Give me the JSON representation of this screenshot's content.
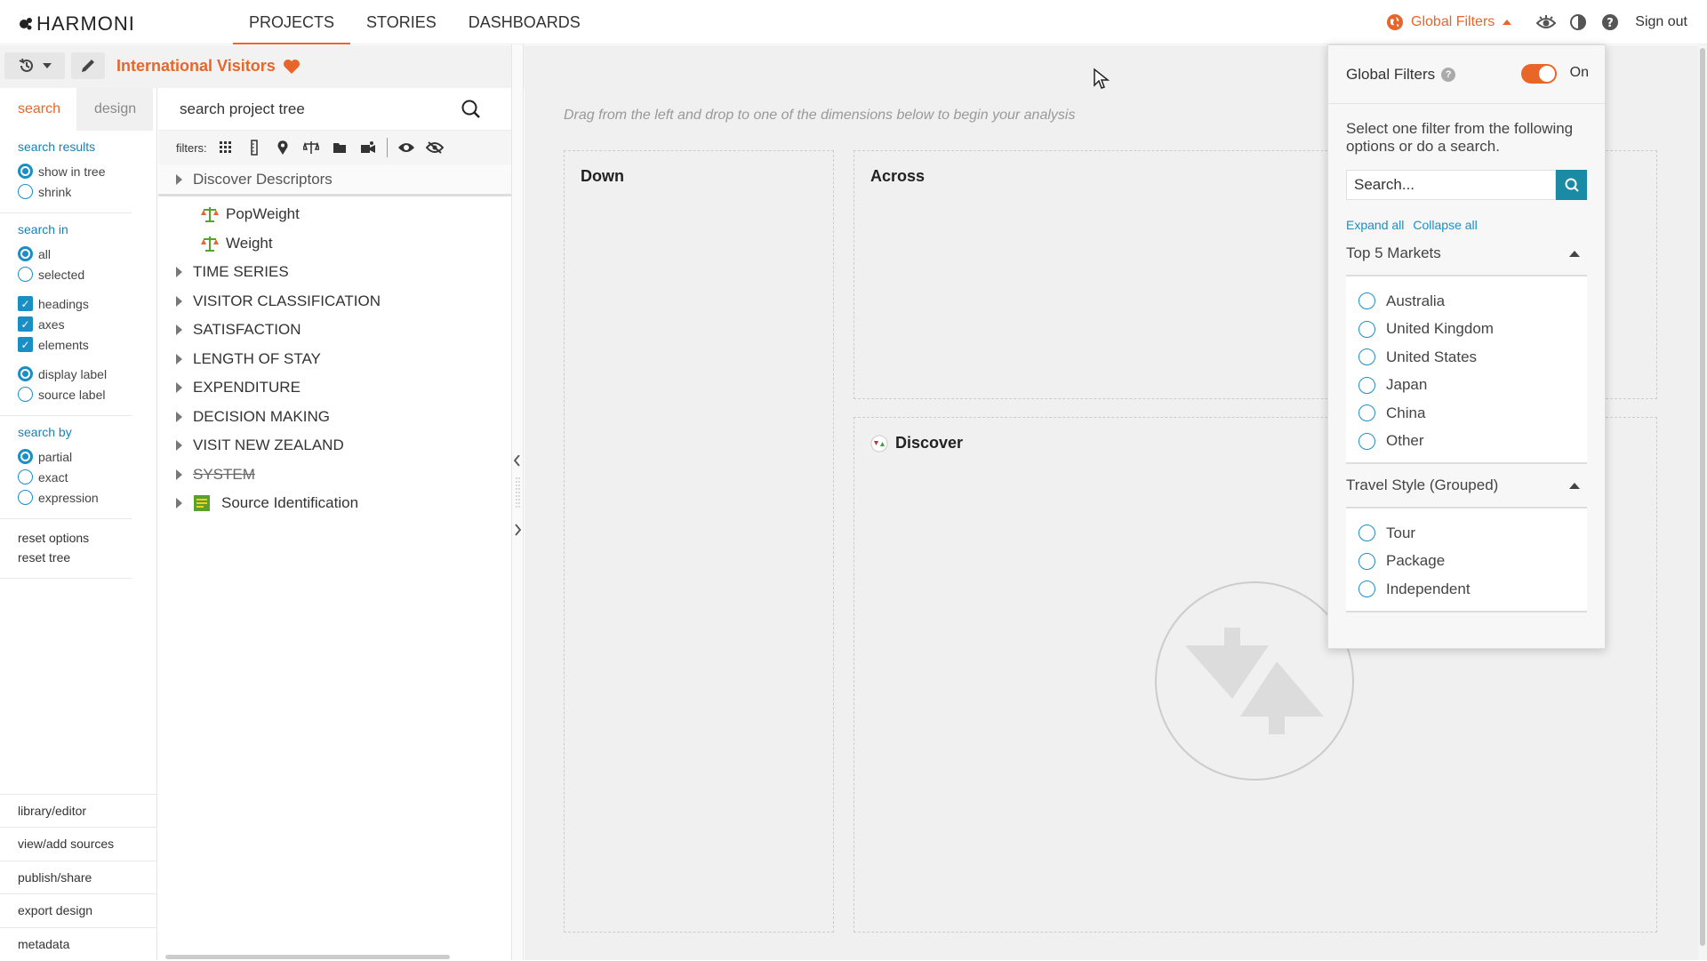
{
  "app": {
    "logo_text": "HARMONI"
  },
  "nav": {
    "items": [
      {
        "label": "PROJECTS",
        "active": true
      },
      {
        "label": "STORIES",
        "active": false
      },
      {
        "label": "DASHBOARDS",
        "active": false
      }
    ]
  },
  "header_right": {
    "global_filters_label": "Global Filters",
    "sign_out": "Sign out"
  },
  "project": {
    "title": "International Visitors"
  },
  "left_tabs": {
    "search": "search",
    "design": "design"
  },
  "options": {
    "search_results": {
      "title": "search results",
      "items": [
        "show in tree",
        "shrink"
      ],
      "selected": 0
    },
    "search_in": {
      "title": "search in",
      "items": [
        "all",
        "selected"
      ],
      "selected": 0
    },
    "checks": [
      "headings",
      "axes",
      "elements"
    ],
    "labels": {
      "items": [
        "display label",
        "source label"
      ],
      "selected": 0
    },
    "search_by": {
      "title": "search by",
      "items": [
        "partial",
        "exact",
        "expression"
      ],
      "selected": 0
    },
    "reset": [
      "reset options",
      "reset tree"
    ]
  },
  "bottom_links": [
    "library/editor",
    "view/add sources",
    "publish/share",
    "export design",
    "metadata"
  ],
  "tree": {
    "search_placeholder": "search project tree",
    "filters_label": "filters:",
    "head": "Discover Descriptors",
    "leaves": [
      "PopWeight",
      "Weight"
    ],
    "folders": [
      "TIME SERIES",
      "VISITOR CLASSIFICATION",
      "SATISFACTION",
      "LENGTH OF STAY",
      "EXPENDITURE",
      "DECISION MAKING",
      "VISIT NEW ZEALAND",
      "SYSTEM"
    ],
    "source": "Source Identification"
  },
  "canvas": {
    "hint": "Drag from the left and drop to one of the dimensions below to begin your analysis",
    "down": "Down",
    "across": "Across",
    "discover": "Discover"
  },
  "global_filters": {
    "title": "Global Filters",
    "toggle_label": "On",
    "description": "Select one filter from the following options or do a search.",
    "search_placeholder": "Search...",
    "expand_all": "Expand all",
    "collapse_all": "Collapse all",
    "groups": [
      {
        "title": "Top 5 Markets",
        "options": [
          "Australia",
          "United Kingdom",
          "United States",
          "Japan",
          "China",
          "Other"
        ]
      },
      {
        "title": "Travel Style (Grouped)",
        "options": [
          "Tour",
          "Package",
          "Independent"
        ]
      }
    ]
  },
  "colors": {
    "accent": "#e8662a",
    "link": "#1a8fc6",
    "search_button": "#1b8aa4"
  }
}
